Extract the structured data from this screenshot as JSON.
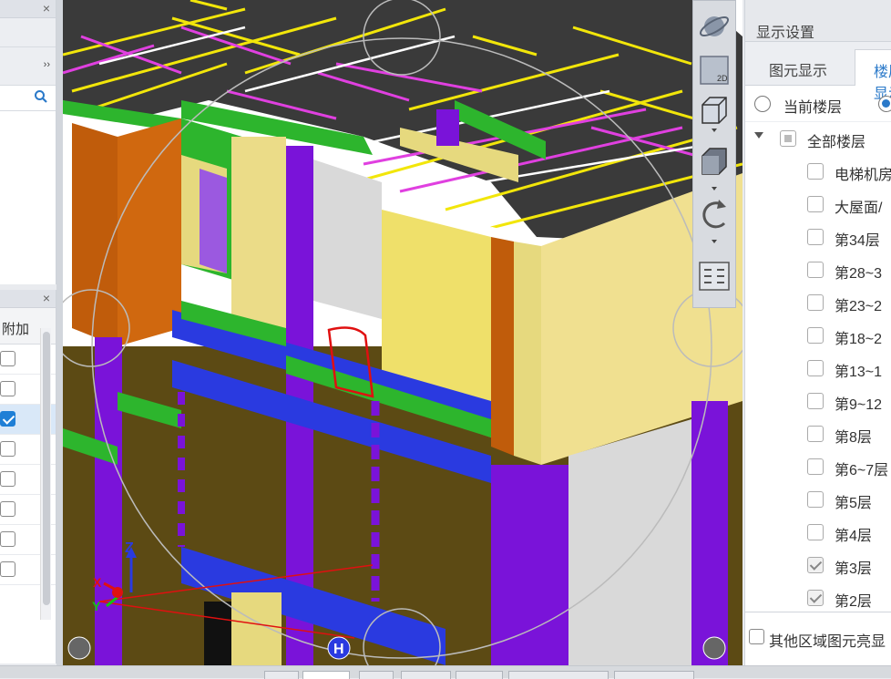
{
  "left_top": {
    "close": "×",
    "more": "››"
  },
  "left_bottom": {
    "close": "×",
    "column_header": "附加",
    "checks": [
      false,
      false,
      true,
      false,
      false,
      false,
      false,
      false
    ]
  },
  "viewport": {
    "axis_labels": {
      "x": "X",
      "y": "Y",
      "z": "Z"
    },
    "marker_label": "H",
    "colors": {
      "slab": "#3a3a3a",
      "beam": "#2db52d",
      "wall": "#e6d97e",
      "column": "#7a13d9",
      "tie_beam": "#2a3ae0",
      "orange": "#c05c0b",
      "rebar_yellow": "#f2e60a",
      "rebar_magenta": "#e040e0",
      "mud": "#5c4a14",
      "gray_wall": "#d9d9d9",
      "annotation": "#e01010"
    }
  },
  "toolbar": {
    "items": [
      "orbit-icon",
      "2d-view-icon",
      "3d-box-icon",
      "view-cube-icon",
      "rotate-icon",
      "layer-list-icon"
    ],
    "label_2d": "2D"
  },
  "right_panel": {
    "title": "显示设置",
    "tabs": [
      "图元显示",
      "楼层显示"
    ],
    "radio_current": "当前楼层",
    "tree_root": "全部楼层",
    "floors": [
      {
        "label": "电梯机房",
        "checked": false
      },
      {
        "label": "大屋面/",
        "checked": false
      },
      {
        "label": "第34层",
        "checked": false
      },
      {
        "label": "第28~3",
        "checked": false
      },
      {
        "label": "第23~2",
        "checked": false
      },
      {
        "label": "第18~2",
        "checked": false
      },
      {
        "label": "第13~1",
        "checked": false
      },
      {
        "label": "第9~12",
        "checked": false
      },
      {
        "label": "第8层",
        "checked": false
      },
      {
        "label": "第6~7层",
        "checked": false
      },
      {
        "label": "第5层",
        "checked": false
      },
      {
        "label": "第4层",
        "checked": false
      },
      {
        "label": "第3层",
        "checked": true
      },
      {
        "label": "第2层",
        "checked": true
      }
    ],
    "bottom_checkbox": "其他区域图元亮显"
  }
}
